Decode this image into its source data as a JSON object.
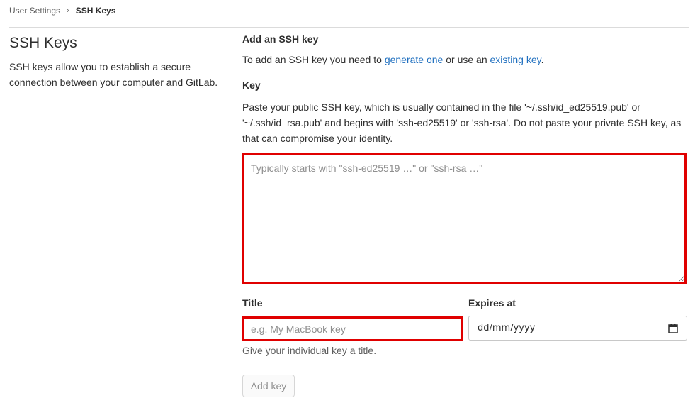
{
  "breadcrumb": {
    "parent": "User Settings",
    "current": "SSH Keys"
  },
  "left": {
    "title": "SSH Keys",
    "description": "SSH keys allow you to establish a secure connection between your computer and GitLab."
  },
  "form": {
    "heading": "Add an SSH key",
    "intro_prefix": "To add an SSH key you need to ",
    "intro_link1": "generate one",
    "intro_middle": " or use an ",
    "intro_link2": "existing key",
    "intro_suffix": ".",
    "key_label": "Key",
    "key_help": "Paste your public SSH key, which is usually contained in the file '~/.ssh/id_ed25519.pub' or '~/.ssh/id_rsa.pub' and begins with 'ssh-ed25519' or 'ssh-rsa'. Do not paste your private SSH key, as that can compromise your identity.",
    "key_placeholder": "Typically starts with \"ssh-ed25519 …\" or \"ssh-rsa …\"",
    "title_label": "Title",
    "title_placeholder": "e.g. My MacBook key",
    "title_help": "Give your individual key a title.",
    "expires_label": "Expires at",
    "expires_value": "dd/mm/yyyy",
    "expires_icon": "calendar-icon",
    "add_button": "Add key"
  },
  "colors": {
    "link": "#1f6fbf",
    "highlight_border": "#e00000",
    "divider": "#dbdbdb"
  }
}
